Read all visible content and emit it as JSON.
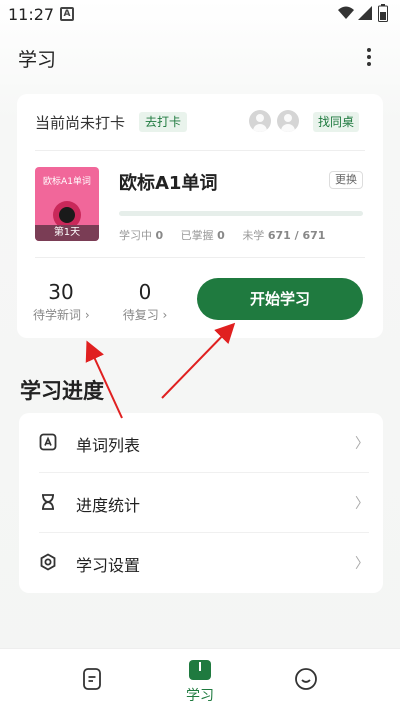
{
  "status_bar": {
    "time": "11:27"
  },
  "app_bar": {
    "title": "学习"
  },
  "card": {
    "checkin_status": "当前尚未打卡",
    "checkin_button": "去打卡",
    "find_deskmate_button": "找同桌",
    "wordbook": {
      "cover_title": "欧标A1单词",
      "cover_day": "第1天",
      "name": "欧标A1单词",
      "swap_button": "更换",
      "progress": 0,
      "stats": {
        "learning_label": "学习中",
        "learning_value": "0",
        "mastered_label": "已掌握",
        "mastered_value": "0",
        "unlearned_label": "未学",
        "unlearned_value": "671 / 671"
      }
    },
    "new_words_count": "30",
    "new_words_label": "待学新词 ›",
    "review_count": "0",
    "review_label": "待复习 ›",
    "start_button": "开始学习"
  },
  "progress_section": {
    "title": "学习进度",
    "items": [
      {
        "label": "单词列表",
        "icon": "word-list-icon"
      },
      {
        "label": "进度统计",
        "icon": "hourglass-icon"
      },
      {
        "label": "学习设置",
        "icon": "settings-icon"
      }
    ]
  },
  "bottom_nav": {
    "active_label": "学习"
  },
  "colors": {
    "accent": "#1f7a3f",
    "accent_light": "#e9f3ec",
    "annotation_arrow": "#e02020"
  }
}
